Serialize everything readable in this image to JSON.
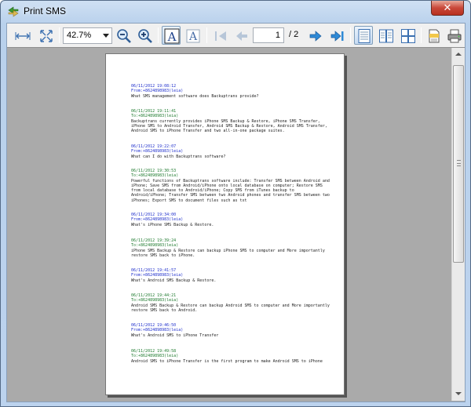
{
  "window": {
    "title": "Print SMS",
    "close_glyph": "✕"
  },
  "toolbar": {
    "zoom_value": "42.7%",
    "current_page": "1",
    "page_separator": "/",
    "total_pages": "2",
    "icons": [
      "fit-width-icon",
      "fit-page-icon",
      "zoom-out-icon",
      "zoom-in-icon",
      "text-select-icon",
      "text-larger-icon",
      "first-page-icon",
      "previous-page-icon",
      "next-page-icon",
      "last-page-icon",
      "single-page-icon",
      "two-pages-icon",
      "four-pages-icon",
      "page-setup-icon",
      "printer-icon"
    ]
  },
  "messages": [
    {
      "type": "in",
      "date": "06/11/2012 19:08:12",
      "who": "From:+8624898983(leia)",
      "body": "What SMS management software does Backuptrans provide?"
    },
    {
      "type": "out",
      "date": "06/11/2012 19:11:41",
      "who": "To:+8624898983(leia)",
      "body": "Backuptrans currently provides iPhone SMS Backup & Restore, iPhone SMS Transfer, iPhone SMS to Android Transfer, Android SMS Backup & Restore, Android SMS Transfer, Android SMS to iPhone Transfer and two all-in-one package suites."
    },
    {
      "type": "in",
      "date": "06/11/2012 19:22:07",
      "who": "From:+8624898983(leia)",
      "body": "What can I do with Backuptrans software?"
    },
    {
      "type": "out",
      "date": "06/11/2012 19:30:53",
      "who": "To:+8624898983(leia)",
      "body": "Powerful functions of Backuptrans software include: Transfer SMS between Android and iPhone; Save SMS from Android/iPhone onto local database on computer; Restore SMS from local database to Android/iPhone; Copy SMS from iTunes backup to Android/iPhone; Transfer SMS between two Android phones and transfer SMS between two iPhones; Export SMS to document files such as txt"
    },
    {
      "type": "in",
      "date": "06/11/2012 19:34:00",
      "who": "From:+8624898983(leia)",
      "body": "What's iPhone SMS Backup & Restore."
    },
    {
      "type": "out",
      "date": "06/11/2012 19:39:24",
      "who": "To:+8624898983(leia)",
      "body": "iPhone SMS Backup & Restore can backup iPhone SMS to computer and More importantly restore SMS back to iPhone."
    },
    {
      "type": "in",
      "date": "06/11/2012 19:41:57",
      "who": "From:+8624898983(leia)",
      "body": "What's Android SMS Backup & Restore."
    },
    {
      "type": "out",
      "date": "06/11/2012 19:44:21",
      "who": "To:+8624898983(leia)",
      "body": "Android SMS Backup & Restore can backup Android SMS to computer and More importantly restore SMS back to Android."
    },
    {
      "type": "in",
      "date": "06/11/2012 19:46:50",
      "who": "From:+8624898983(leia)",
      "body": "What's Android SMS to iPhone Transfer"
    },
    {
      "type": "out",
      "date": "06/11/2012 19:49:58",
      "who": "To:+8624898983(leia)",
      "body": "Android SMS to iPhone Transfer is the first program to make Android SMS to iPhone"
    }
  ]
}
